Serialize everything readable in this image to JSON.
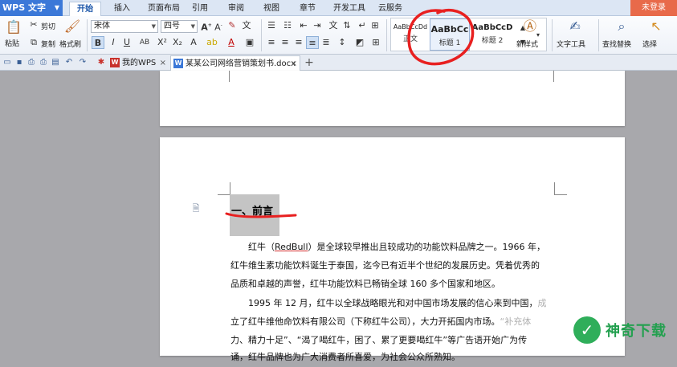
{
  "app": {
    "name": "WPS 文字",
    "login": "未登录"
  },
  "tabs": [
    "开始",
    "插入",
    "页面布局",
    "引用",
    "审阅",
    "视图",
    "章节",
    "开发工具",
    "云服务"
  ],
  "ribbon": {
    "clipboard": {
      "paste": "粘贴",
      "cut": "剪切",
      "copy": "复制",
      "format_painter": "格式刷"
    },
    "font": {
      "name": "宋体",
      "size": "四号"
    },
    "styles": [
      {
        "sample": "AaBbCcDd",
        "name": "正文"
      },
      {
        "sample": "AaBbCc",
        "name": "标题 1"
      },
      {
        "sample": "AaBbCcD",
        "name": "标题 2"
      }
    ],
    "new_style": "新样式",
    "text_tools": "文字工具",
    "find_replace": "查找替换",
    "select": "选择"
  },
  "doc_tabs": [
    {
      "label": "我的WPS"
    },
    {
      "label": "某某公司网络营销策划书.docx *"
    }
  ],
  "document": {
    "heading": "一、前言",
    "lines": [
      {
        "pre": "红牛（",
        "ul": "RedBull",
        "post": "）是全球较早推出且较成功的功能饮料品牌之一。1966 年，",
        "fade": ""
      },
      {
        "pre": "红牛维生素功能饮料诞生于泰国，迄今已有近半个世纪的发展历史。凭着优秀的",
        "ul": "",
        "post": "",
        "fade": ""
      },
      {
        "pre": "品质和卓越的声誉，红牛功能饮料已畅销全球 160 多个国家和地区。",
        "ul": "",
        "post": "",
        "fade": ""
      },
      {
        "pre": "1995 年 12 月，红牛以全球战略眼光和对中国市场发展的信心来到中国，",
        "ul": "",
        "post": "",
        "fade": "成"
      },
      {
        "pre": "立了红牛维他命饮料有限公司（下称红牛公司），大力开拓国内市场。",
        "ul": "",
        "post": "",
        "fade": "“补充体"
      },
      {
        "pre": "力、精力十足”、“渴了喝红牛，困了、累了更要喝红牛”等广告语开始广为传",
        "ul": "",
        "post": "",
        "fade": ""
      },
      {
        "pre": "诵，红牛品牌也为广大消费者所喜爱，为社会公众所熟知。",
        "ul": "",
        "post": "",
        "fade": ""
      }
    ]
  },
  "watermark": {
    "text": "神奇下载"
  }
}
